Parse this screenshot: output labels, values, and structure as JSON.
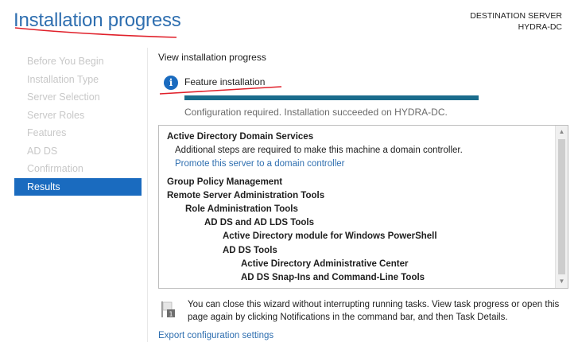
{
  "header": {
    "title": "Installation progress",
    "destination_label": "DESTINATION SERVER",
    "destination_server": "HYDRA-DC"
  },
  "sidebar": {
    "items": [
      {
        "label": "Before You Begin"
      },
      {
        "label": "Installation Type"
      },
      {
        "label": "Server Selection"
      },
      {
        "label": "Server Roles"
      },
      {
        "label": "Features"
      },
      {
        "label": "AD DS"
      },
      {
        "label": "Confirmation"
      },
      {
        "label": "Results",
        "active": true
      }
    ]
  },
  "main": {
    "section_label": "View installation progress",
    "feature_title": "Feature installation",
    "progress_fraction": 1.0,
    "status": "Configuration required. Installation succeeded on HYDRA-DC.",
    "results": {
      "adds_title": "Active Directory Domain Services",
      "adds_note": "Additional steps are required to make this machine a domain controller.",
      "promote_link": "Promote this server to a domain controller",
      "gpm": "Group Policy Management",
      "rsat": "Remote Server Administration Tools",
      "role_admin": "Role Administration Tools",
      "adds_lds_tools": "AD DS and AD LDS Tools",
      "ps_module": "Active Directory module for Windows PowerShell",
      "adds_tools": "AD DS Tools",
      "admin_center": "Active Directory Administrative Center",
      "snapins": "AD DS Snap-Ins and Command-Line Tools"
    },
    "note": "You can close this wizard without interrupting running tasks. View task progress or open this page again by clicking Notifications in the command bar, and then Task Details.",
    "export_link": "Export configuration settings"
  },
  "colors": {
    "accent": "#1a6bbf",
    "progress": "#1a6c8c",
    "annotation": "#e0202a"
  },
  "icons": [
    "info-icon",
    "flag-icon",
    "chevron-up-icon",
    "chevron-down-icon"
  ]
}
